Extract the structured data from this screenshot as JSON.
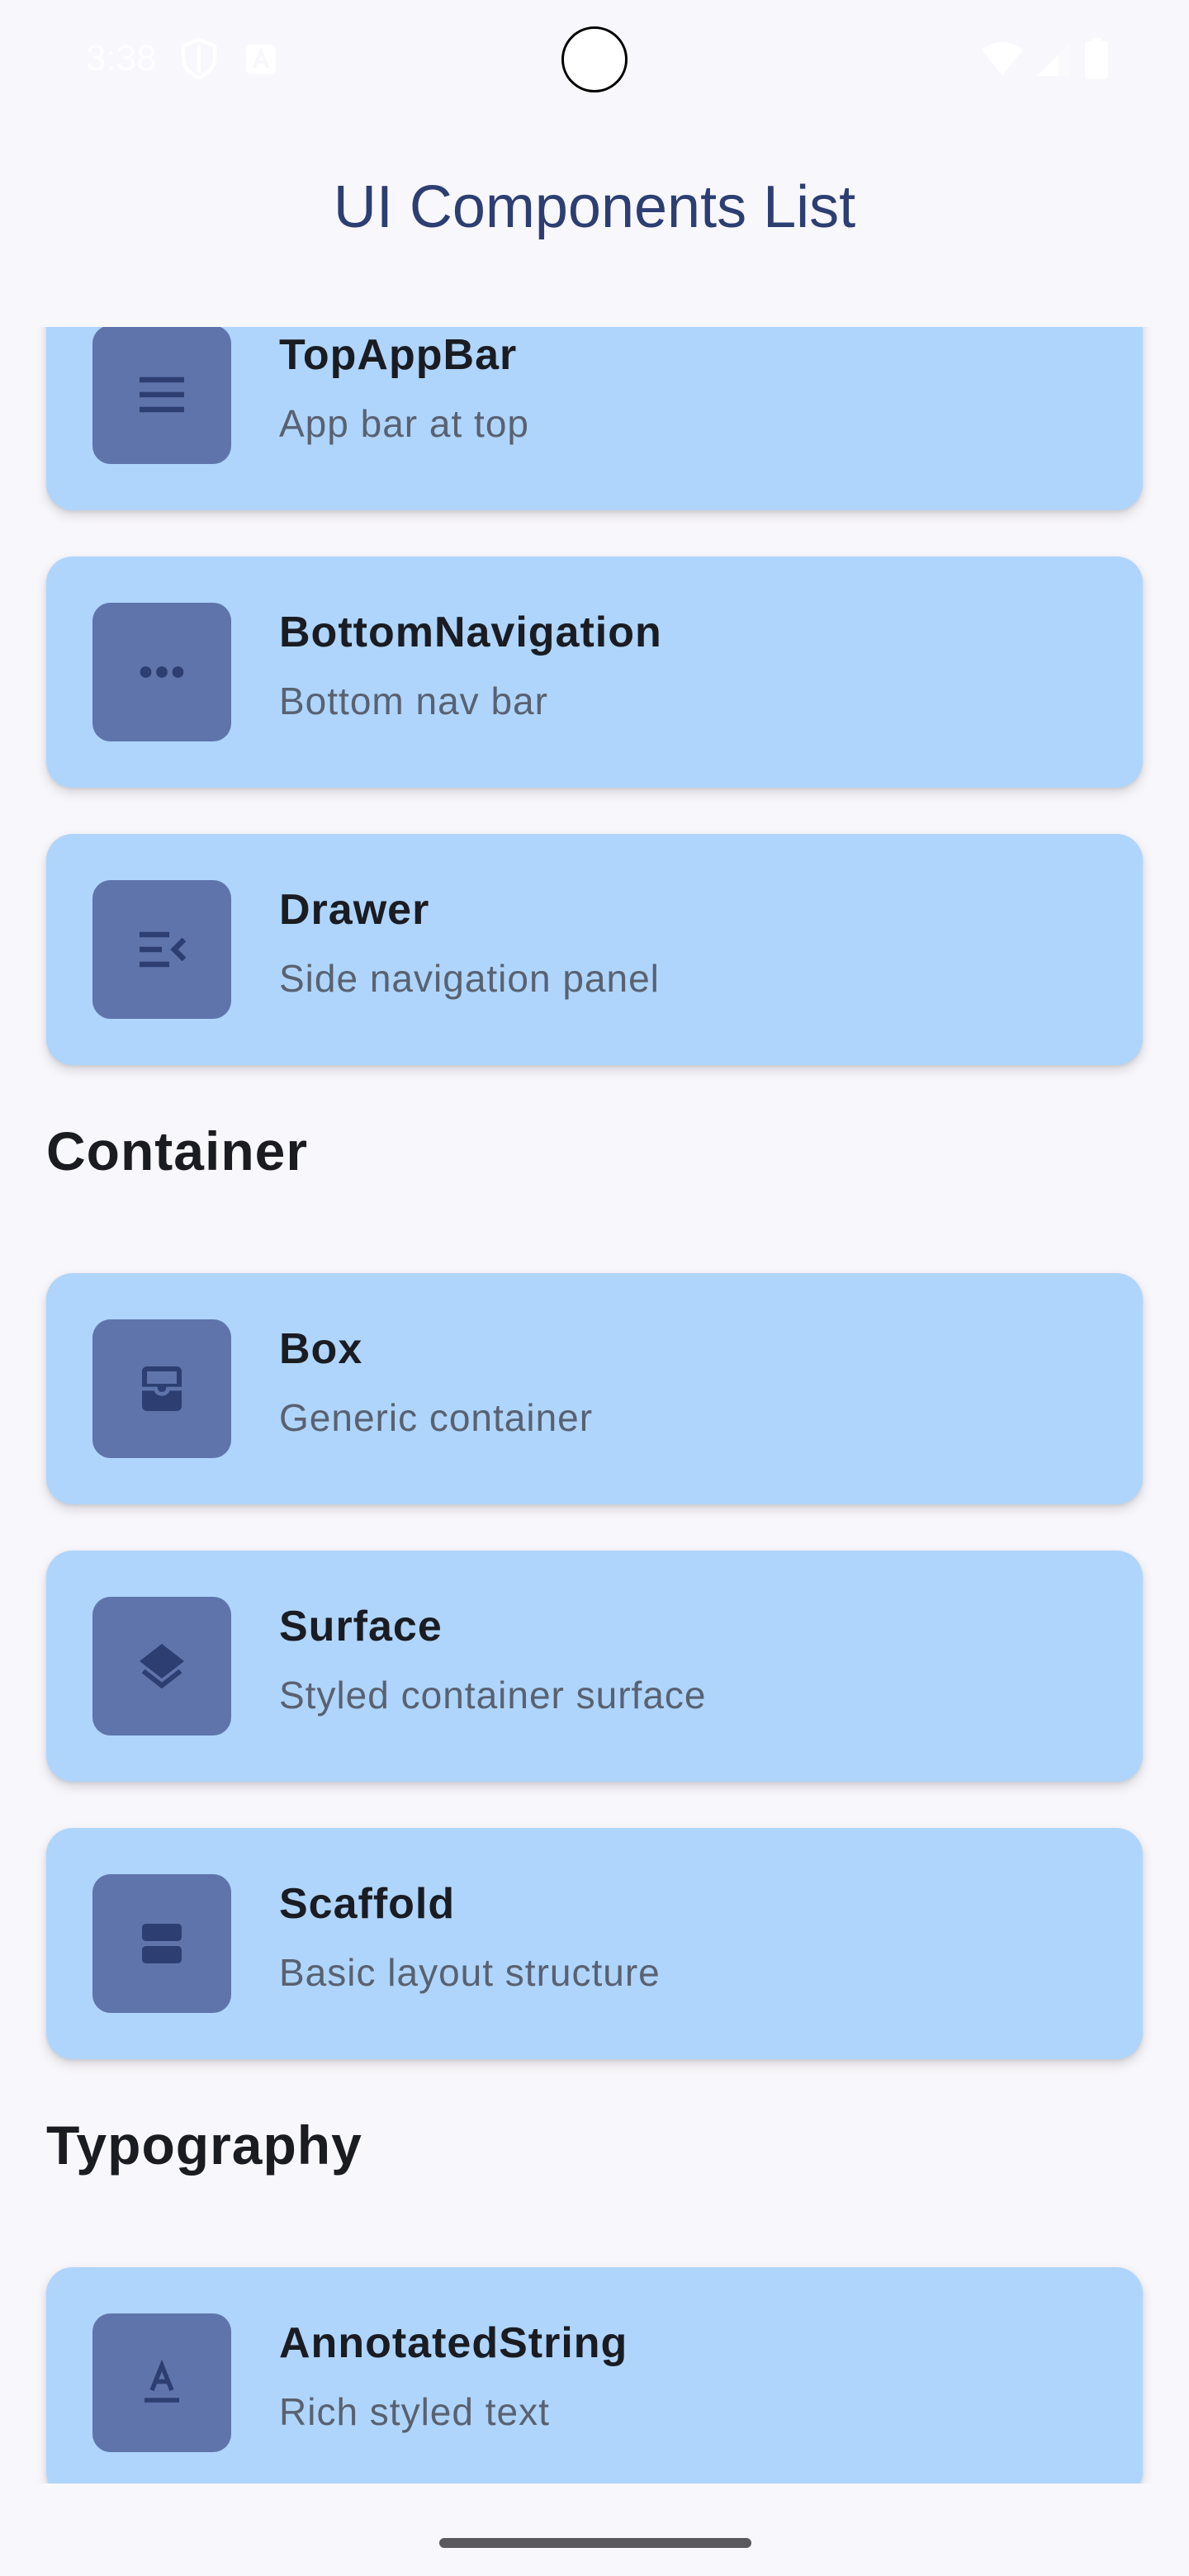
{
  "status_bar": {
    "time": "3:38",
    "icons": [
      "shield-icon",
      "notification-a-icon",
      "wifi-icon",
      "signal-icon",
      "battery-icon"
    ]
  },
  "app_bar": {
    "title": "UI Components List"
  },
  "sections": [
    {
      "header": "",
      "items": [
        {
          "title": "TopAppBar",
          "subtitle": "App bar at top",
          "icon": "menu-icon"
        },
        {
          "title": "BottomNavigation",
          "subtitle": "Bottom nav bar",
          "icon": "more-horiz-icon"
        },
        {
          "title": "Drawer",
          "subtitle": "Side navigation panel",
          "icon": "menu-open-icon"
        }
      ]
    },
    {
      "header": "Container",
      "items": [
        {
          "title": "Box",
          "subtitle": "Generic container",
          "icon": "inbox-icon"
        },
        {
          "title": "Surface",
          "subtitle": "Styled container surface",
          "icon": "layers-icon"
        },
        {
          "title": "Scaffold",
          "subtitle": "Basic layout structure",
          "icon": "view-agenda-icon"
        }
      ]
    },
    {
      "header": "Typography",
      "items": [
        {
          "title": "AnnotatedString",
          "subtitle": "Rich styled text",
          "icon": "text-format-icon"
        }
      ]
    }
  ],
  "colors": {
    "background": "#f8f7fc",
    "card": "#afd5fc",
    "icon_box": "#5f74ab",
    "icon_glyph": "#2c3e72",
    "title_text": "#2c3e72"
  }
}
